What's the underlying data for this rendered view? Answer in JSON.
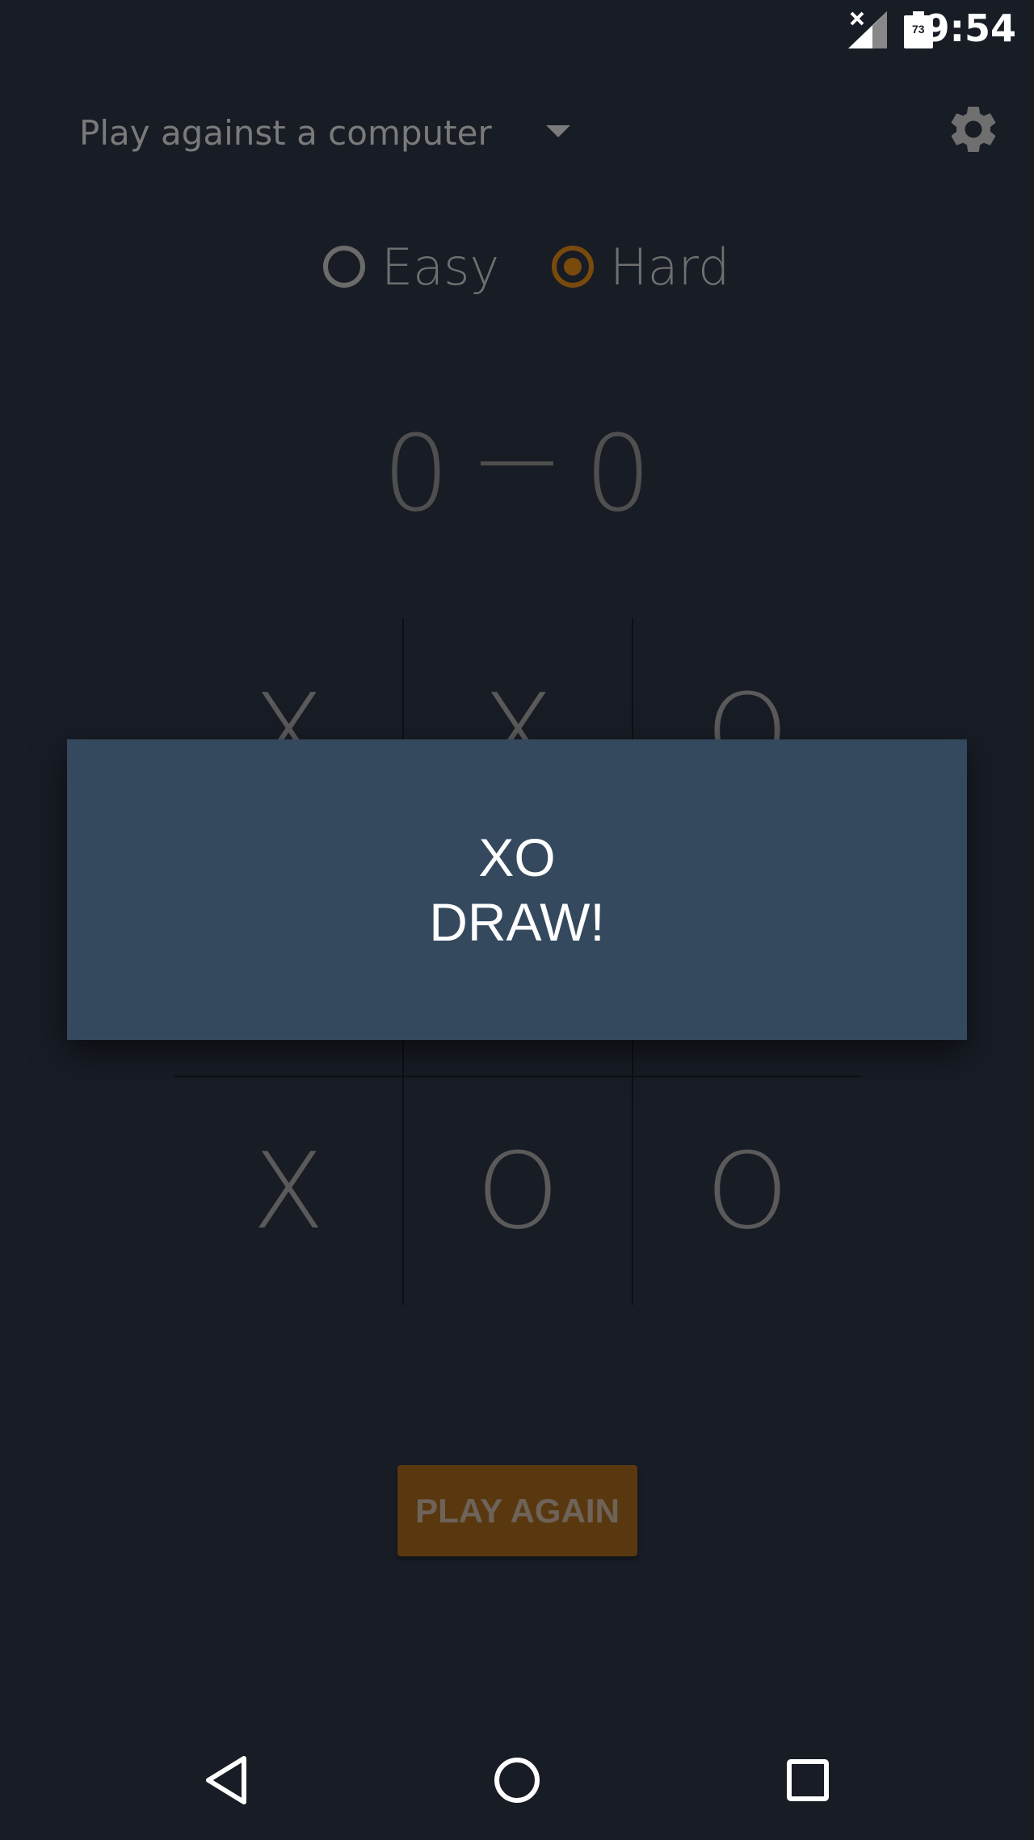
{
  "status_bar": {
    "time": "9:54",
    "battery_level": "73",
    "icons": [
      "signal-no-data-icon",
      "battery-icon"
    ]
  },
  "top_bar": {
    "mode_label": "Play against a computer",
    "dropdown_icon": "chevron-down-icon",
    "settings_icon": "gear-icon"
  },
  "difficulty": {
    "options": [
      {
        "label": "Easy",
        "selected": false
      },
      {
        "label": "Hard",
        "selected": true
      }
    ],
    "accent_color": "#7a4a0d"
  },
  "score": {
    "player": "0",
    "opponent": "0"
  },
  "board": {
    "cells": [
      "X",
      "X",
      "O",
      "",
      "",
      "",
      "X",
      "O",
      "O"
    ]
  },
  "dialog": {
    "line1": "XO",
    "line2": "DRAW!",
    "background": "#34495e"
  },
  "play_again_label": "PLAY AGAIN",
  "nav_bar": {
    "icons": [
      "back-icon",
      "home-icon",
      "recents-icon"
    ]
  }
}
